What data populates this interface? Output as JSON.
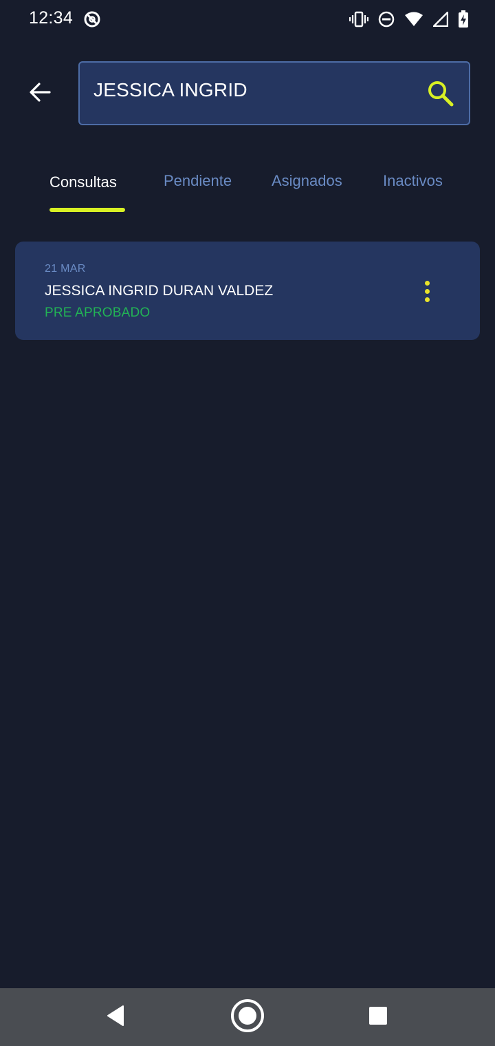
{
  "status_bar": {
    "time": "12:34",
    "icons": [
      "app-notification-icon",
      "vibrate-icon",
      "do-not-disturb-icon",
      "wifi-icon",
      "signal-icon",
      "battery-charging-icon"
    ]
  },
  "header": {
    "back_icon": "arrow-left-icon",
    "search": {
      "value": "JESSICA INGRID",
      "icon": "search-icon"
    }
  },
  "tabs": [
    {
      "label": "Consultas",
      "active": true
    },
    {
      "label": "Pendiente",
      "active": false
    },
    {
      "label": "Asignados",
      "active": false
    },
    {
      "label": "Inactivos",
      "active": false
    }
  ],
  "results": [
    {
      "date": "21 MAR",
      "name": "JESSICA INGRID DURAN VALDEZ",
      "status": "PRE APROBADO",
      "menu_icon": "more-vertical-icon"
    }
  ],
  "nav_bar": {
    "icons": [
      "nav-back-icon",
      "nav-home-icon",
      "nav-recents-icon"
    ]
  },
  "colors": {
    "background": "#171c2c",
    "card": "#253660",
    "accent": "#d8f024",
    "status_ok": "#22b455",
    "muted": "#6a8bc4"
  }
}
